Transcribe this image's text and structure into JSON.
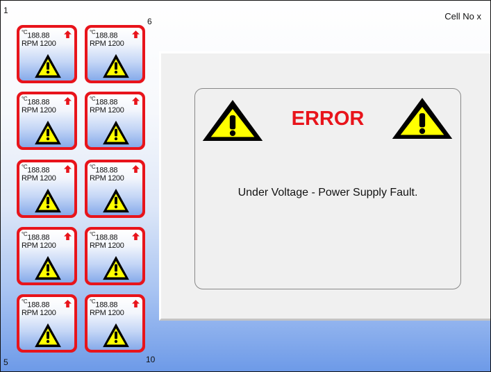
{
  "header": {
    "cell_label": "Cell No  x"
  },
  "corner_numbers": {
    "top_left": "1",
    "top_right": "6",
    "bottom_left": "5",
    "bottom_right": "10"
  },
  "tiles": [
    {
      "id": 1,
      "temp": "188.88",
      "temp_unit": "°C",
      "rpm": "RPM 1200",
      "trend": "up",
      "status": "warning"
    },
    {
      "id": 2,
      "temp": "188.88",
      "temp_unit": "°C",
      "rpm": "RPM 1200",
      "trend": "up",
      "status": "warning"
    },
    {
      "id": 3,
      "temp": "188.88",
      "temp_unit": "°C",
      "rpm": "RPM 1200",
      "trend": "up",
      "status": "warning"
    },
    {
      "id": 4,
      "temp": "188.88",
      "temp_unit": "°C",
      "rpm": "RPM 1200",
      "trend": "up",
      "status": "warning"
    },
    {
      "id": 5,
      "temp": "188.88",
      "temp_unit": "°C",
      "rpm": "RPM 1200",
      "trend": "up",
      "status": "warning"
    },
    {
      "id": 6,
      "temp": "188.88",
      "temp_unit": "°C",
      "rpm": "RPM 1200",
      "trend": "up",
      "status": "warning"
    },
    {
      "id": 7,
      "temp": "188.88",
      "temp_unit": "°C",
      "rpm": "RPM 1200",
      "trend": "up",
      "status": "warning"
    },
    {
      "id": 8,
      "temp": "188.88",
      "temp_unit": "°C",
      "rpm": "RPM 1200",
      "trend": "up",
      "status": "warning"
    },
    {
      "id": 9,
      "temp": "188.88",
      "temp_unit": "°C",
      "rpm": "RPM 1200",
      "trend": "up",
      "status": "warning"
    },
    {
      "id": 10,
      "temp": "188.88",
      "temp_unit": "°C",
      "rpm": "RPM 1200",
      "trend": "up",
      "status": "warning"
    }
  ],
  "error_dialog": {
    "title": "ERROR",
    "message": "Under Voltage - Power Supply Fault.",
    "icon": "warning-triangle-icon"
  },
  "colors": {
    "tile_border": "#e8141b",
    "error_text": "#e8141b",
    "warning_yellow": "#ffff00",
    "arrow_red": "#e8141b"
  }
}
